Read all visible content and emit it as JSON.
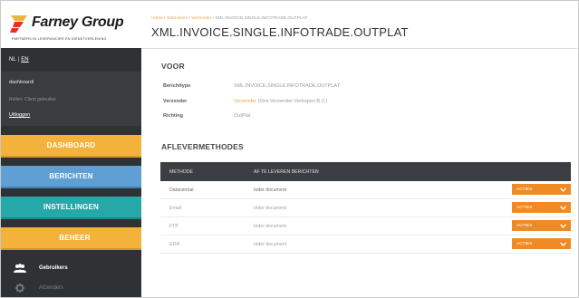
{
  "brand": {
    "name": "Farney Group",
    "tagline": "PARTNERS IN LEVERANCIER EN DIENSTVERLENING",
    "colors": {
      "orange": "#f3b33a",
      "red": "#e2331b",
      "blue": "#5f9fd3",
      "teal": "#27a8a8",
      "action": "#f08a24"
    }
  },
  "lang": {
    "nl": "NL",
    "sep": "|",
    "en": "EN"
  },
  "user": {
    "name": "dashboardi",
    "role": "Rollen: Client gebruiker",
    "logout": "Uitloggen"
  },
  "nav": {
    "dashboard": "DASHBOARD",
    "berichten": "BERICHTEN",
    "instellingen": "INSTELLINGEN",
    "beheer": "BEHEER",
    "sub": [
      {
        "label": "Gebruikers",
        "icon": "users-icon"
      },
      {
        "label": "Afzenders",
        "icon": "gear-icon"
      }
    ]
  },
  "breadcrumb": {
    "home": "Home",
    "sep1": "/",
    "users": "Gebruikers",
    "sep2": "/",
    "senders": "Verzender",
    "sep3": "/",
    "current": "XML.INVOICE.SINGLE.INFOTRADE.OUTPLAT"
  },
  "page_title": "XML.INVOICE.SINGLE.INFOTRADE.OUTPLAT",
  "voor": {
    "heading": "VOOR",
    "fields": [
      {
        "key": "Berichttype",
        "value": "XML.INVOICE.SINGLE.INFOTRADE.OUTPLAT",
        "link": ""
      },
      {
        "key": "Verzender",
        "value": "(Ons Verzender Verkopen B.V.)",
        "link": "Verzender"
      },
      {
        "key": "Richting",
        "value": "OutPlat",
        "link": ""
      }
    ]
  },
  "aflever": {
    "heading": "AFLEVERMETHODES",
    "columns": {
      "methode": "METHODE",
      "berichten": "AF TE LEVEREN BERICHTEN"
    },
    "rows": [
      {
        "methode": "Datacentral",
        "berichten": "Ieder document",
        "action": "ACTIES"
      },
      {
        "methode": "Email",
        "berichten": "Ieder document",
        "action": "ACTIES"
      },
      {
        "methode": "FTP",
        "berichten": "Ieder document",
        "action": "ACTIES"
      },
      {
        "methode": "EDIF",
        "berichten": "Ieder document",
        "action": "ACTIES"
      }
    ]
  }
}
